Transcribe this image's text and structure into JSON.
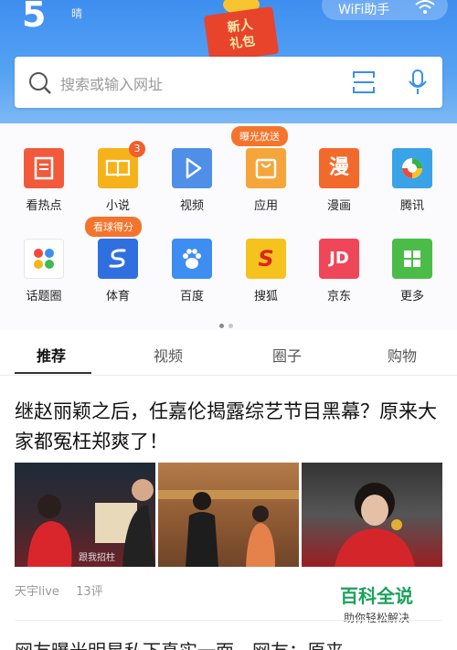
{
  "status": {
    "temperature": "5",
    "weather": "晴",
    "wifi_label": "WiFi助手"
  },
  "promo": {
    "line1": "新人",
    "line2": "礼包"
  },
  "search": {
    "placeholder": "搜索或输入网址"
  },
  "shortcuts": [
    {
      "label": "看热点",
      "color": "#f25a3b",
      "icon": "news-icon"
    },
    {
      "label": "小说",
      "color": "#f6b21a",
      "icon": "book-icon",
      "badge": "3"
    },
    {
      "label": "视频",
      "color": "#4f8fe8",
      "icon": "play-icon"
    },
    {
      "label": "应用",
      "color": "#f5a53a",
      "icon": "bag-icon",
      "bubble": "曝光放送"
    },
    {
      "label": "漫画",
      "color": "#f26a2b",
      "icon": "comic-icon",
      "text": "漫"
    },
    {
      "label": "腾讯",
      "color": "#3aa3e8",
      "icon": "tencent-icon"
    },
    {
      "label": "话题圈",
      "color": "#ffffff",
      "icon": "topic-icon"
    },
    {
      "label": "体育",
      "color": "#2f6fe0",
      "icon": "sports-icon",
      "bubble": "看球得分"
    },
    {
      "label": "百度",
      "color": "#3d8ef0",
      "icon": "paw-icon"
    },
    {
      "label": "搜狐",
      "color": "#f6c21e",
      "icon": "sohu-icon",
      "text": "S"
    },
    {
      "label": "京东",
      "color": "#f0465a",
      "icon": "jd-icon",
      "text": "JD"
    },
    {
      "label": "更多",
      "color": "#4cbc48",
      "icon": "more-grid-icon"
    }
  ],
  "tabs": [
    "推荐",
    "视频",
    "圈子",
    "购物"
  ],
  "article": {
    "title": "继赵丽颖之后，任嘉伦揭露综艺节目黑幕？原来大家都冤枉郑爽了！",
    "image_caption": "跟我招柱",
    "source": "天宇live",
    "comments": "13评"
  },
  "watermark": {
    "title": "百科全说",
    "subtitle": "助你轻松解决"
  },
  "next_article_peek": "网友曝光明星私下真实一面，网友：原来"
}
